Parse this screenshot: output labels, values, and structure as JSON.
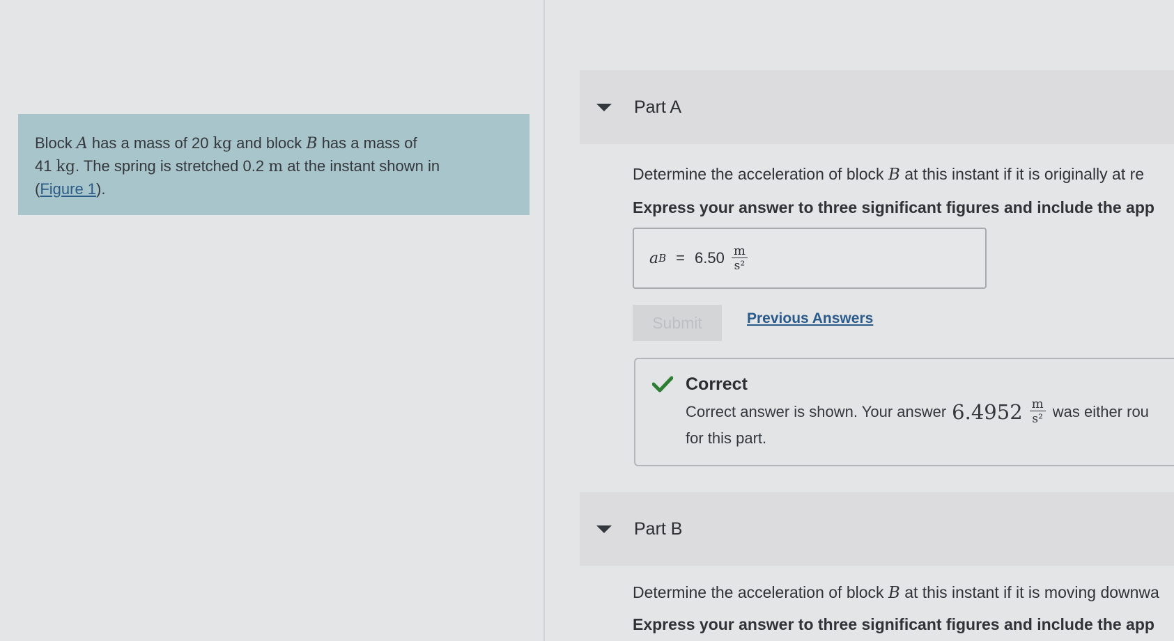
{
  "problem": {
    "text_1": "Block ",
    "block_a": "A",
    "text_2": " has a mass of 20 ",
    "unit_kg_1": "kg",
    "text_3": " and block ",
    "block_b": "B",
    "text_4": " has a mass of",
    "text_5": "41 ",
    "unit_kg_2": "kg",
    "text_6": ". The spring is stretched 0.2 ",
    "unit_m": "m",
    "text_7": " at the instant shown in",
    "paren_open": "(",
    "figure_link": "Figure 1",
    "paren_close": ")."
  },
  "part_a": {
    "title": "Part A",
    "question_1": "Determine the acceleration of block ",
    "question_var": "B",
    "question_2": " at this instant if it is originally at re",
    "instruction": "Express your answer to three significant figures and include the app",
    "answer": {
      "var": "a",
      "sub": "B",
      "equals": "=",
      "value": "6.50",
      "unit_num": "m",
      "unit_den": "s²"
    },
    "submit_label": "Submit",
    "previous_answers_label": "Previous Answers",
    "feedback": {
      "title": "Correct",
      "line_1": "Correct answer is shown. Your answer",
      "your_answer": "6.4952",
      "unit_num": "m",
      "unit_den": "s²",
      "line_1_end": "was either rou",
      "line_2": "for this part."
    }
  },
  "part_b": {
    "title": "Part B",
    "question_1": "Determine the acceleration of block ",
    "question_var": "B",
    "question_2": " at this instant if it is moving downwa",
    "instruction": "Express your answer to three significant figures and include the app"
  },
  "colors": {
    "background": "#e4e5e7",
    "problem_box": "#a9c5cc",
    "link": "#2a5a8a",
    "check": "#2e7d32"
  }
}
